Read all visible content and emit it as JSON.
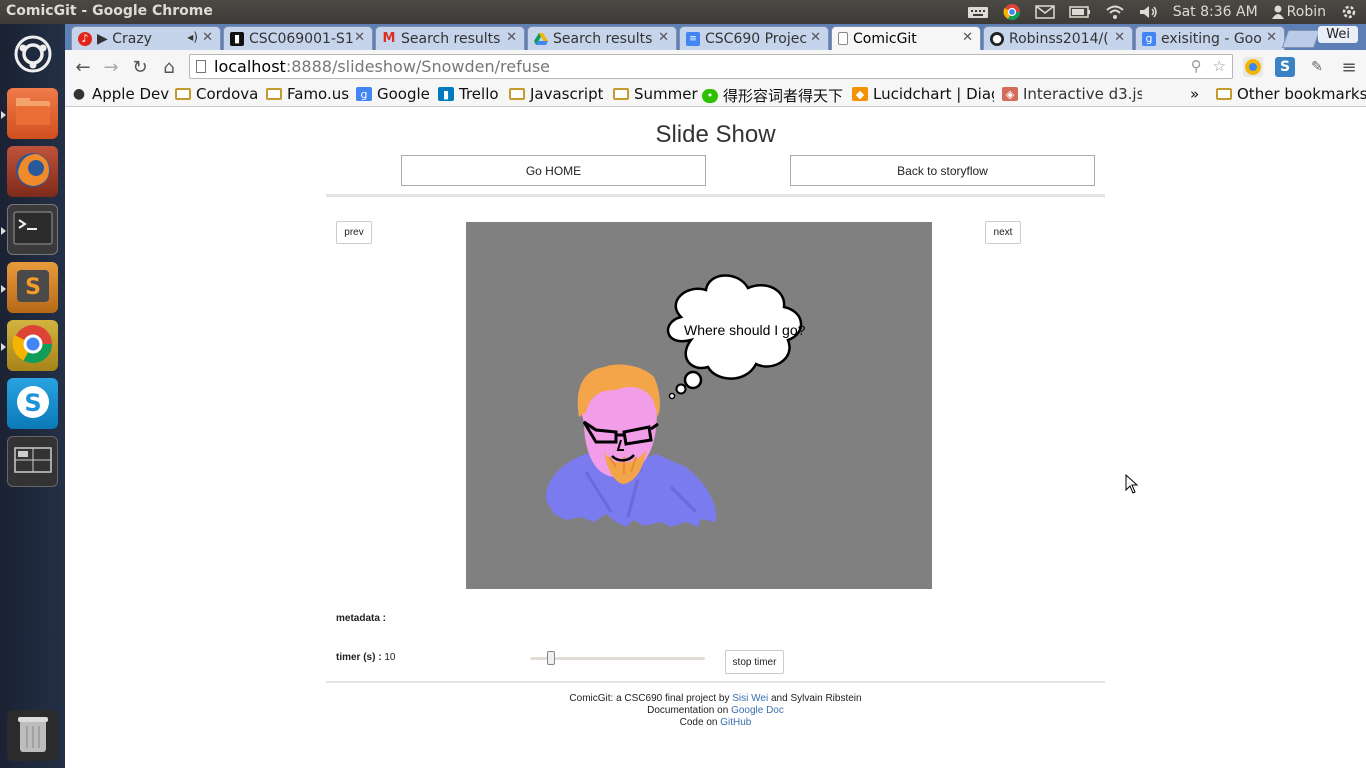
{
  "os": {
    "window_title": "ComicGit - Google Chrome",
    "clock": "Sat 8:36 AM",
    "user": "Robin"
  },
  "launcher": {
    "items": [
      "Ubuntu Dash",
      "Files",
      "Firefox",
      "Terminal",
      "Sublime Text",
      "Chrome",
      "Skype",
      "Workspace Switcher",
      "Trash"
    ]
  },
  "browser": {
    "tabs": [
      {
        "label": "▶ Crazy",
        "icon": "music-icon"
      },
      {
        "label": "CSC069001-S1",
        "icon": "page-icon"
      },
      {
        "label": "Search results",
        "icon": "gmail-icon"
      },
      {
        "label": "Search results",
        "icon": "drive-icon"
      },
      {
        "label": "CSC690 Projec",
        "icon": "docs-icon"
      },
      {
        "label": "ComicGit",
        "icon": "page-icon"
      },
      {
        "label": "Robinss2014/(",
        "icon": "github-icon"
      },
      {
        "label": "exisiting - Goo",
        "icon": "google-icon"
      }
    ],
    "profile": "Wei",
    "address_host": "localhost",
    "address_rest": ":8888/slideshow/Snowden/refuse",
    "bookmarks": [
      {
        "label": "Apple Dev",
        "icon": "folder"
      },
      {
        "label": "Cordova",
        "icon": "folder"
      },
      {
        "label": "Famo.us",
        "icon": "folder"
      },
      {
        "label": "Google",
        "icon": "google"
      },
      {
        "label": "Trello",
        "icon": "trello"
      },
      {
        "label": "Javascript",
        "icon": "folder"
      },
      {
        "label": "Summer",
        "icon": "folder"
      },
      {
        "label": "得形容词者得天下",
        "icon": "wechat"
      },
      {
        "label": "Lucidchart | Diagr",
        "icon": "lucid"
      },
      {
        "label": "Interactive d3.js t",
        "icon": "d3"
      }
    ],
    "bookmarks_overflow": "»",
    "other_bookmarks": "Other bookmarks"
  },
  "page": {
    "title": "Slide Show",
    "home_button": "Go HOME",
    "storyflow_button": "Back to storyflow",
    "prev_button": "prev",
    "next_button": "next",
    "speech_bubble": "Where should I go?",
    "metadata_label": "metadata :",
    "timer_label": "timer (s) :",
    "timer_value": "10",
    "timer_slider_fraction": 0.1,
    "stop_timer_button": "stop timer",
    "footer": {
      "line1_prefix": "ComicGit: a CSC690 final project by",
      "author1": "Sisi Wei",
      "line1_mid": "and Sylvain Ribstein",
      "line2_prefix": "Documentation on",
      "doc_link": "Google Doc",
      "line3_prefix": "Code on",
      "code_link": "GitHub"
    }
  }
}
